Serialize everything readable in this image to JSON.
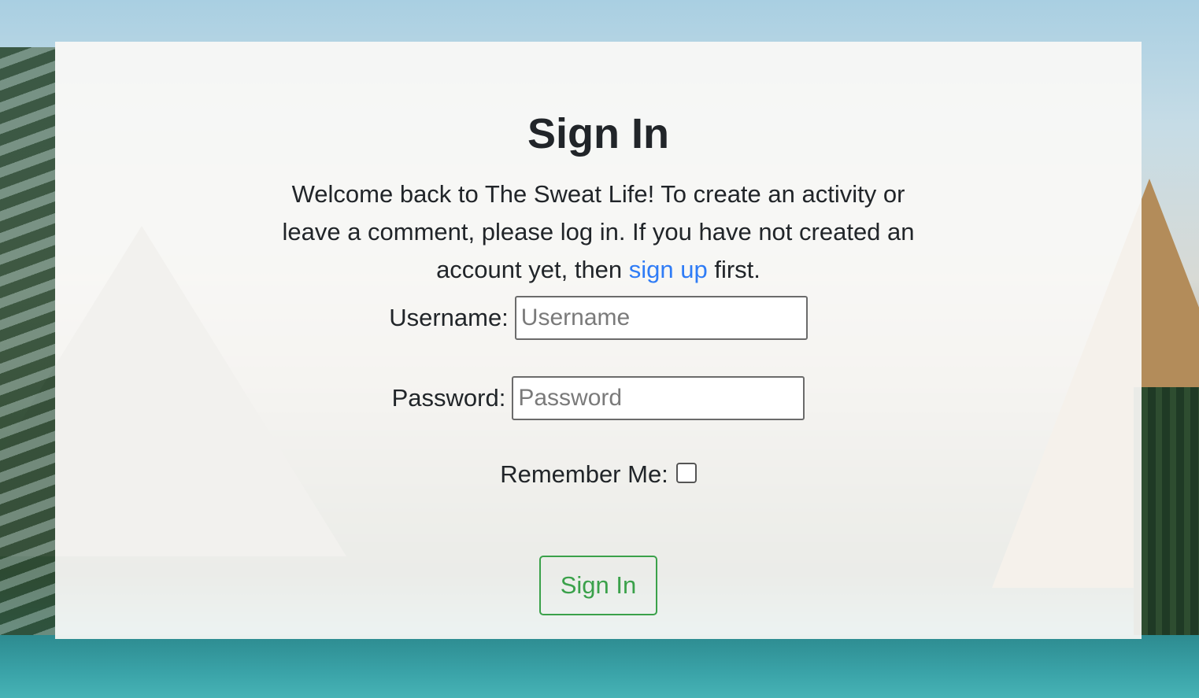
{
  "page": {
    "title": "Sign In",
    "intro_before_link": "Welcome back to The Sweat Life! To create an activity or leave a comment, please log in. If you have not created an account yet, then ",
    "intro_link": "sign up",
    "intro_after_link": " first."
  },
  "form": {
    "username_label": "Username:",
    "username_placeholder": "Username",
    "username_value": "",
    "password_label": "Password:",
    "password_placeholder": "Password",
    "password_value": "",
    "remember_label": "Remember Me:",
    "remember_checked": false,
    "submit_label": "Sign In"
  },
  "colors": {
    "link": "#2f7cf6",
    "button_accent": "#3aa14a",
    "text": "#212529"
  }
}
